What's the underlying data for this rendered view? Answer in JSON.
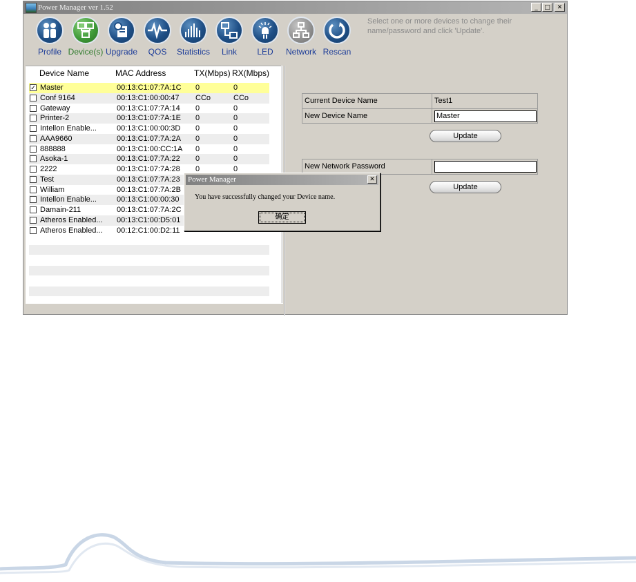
{
  "window": {
    "title": "Power Manager ver 1.52"
  },
  "window_buttons": {
    "minimize": "_",
    "maximize": "□",
    "close": "✕"
  },
  "toolbar": {
    "items": [
      {
        "label": "Profile",
        "icon": "profile-icon"
      },
      {
        "label": "Device(s)",
        "icon": "devices-icon"
      },
      {
        "label": "Upgrade",
        "icon": "upgrade-icon"
      },
      {
        "label": "QOS",
        "icon": "qos-icon"
      },
      {
        "label": "Statistics",
        "icon": "statistics-icon"
      },
      {
        "label": "Link",
        "icon": "link-icon"
      },
      {
        "label": "LED",
        "icon": "led-icon"
      },
      {
        "label": "Network",
        "icon": "network-icon"
      },
      {
        "label": "Rescan",
        "icon": "rescan-icon"
      }
    ],
    "active": "Device(s)"
  },
  "hint": "Select one or more devices to change their name/password and click 'Update'.",
  "device_list": {
    "columns": [
      "Device Name",
      "MAC Address",
      "TX(Mbps)",
      "RX(Mbps)"
    ],
    "rows": [
      {
        "checked": true,
        "name": "Master",
        "mac": "00:13:C1:07:7A:1C",
        "tx": "0",
        "rx": "0"
      },
      {
        "checked": false,
        "name": "Conf 9164",
        "mac": "00:13:C1:00:00:47",
        "tx": "CCo",
        "rx": "CCo"
      },
      {
        "checked": false,
        "name": "Gateway",
        "mac": "00:13:C1:07:7A:14",
        "tx": "0",
        "rx": "0"
      },
      {
        "checked": false,
        "name": "Printer-2",
        "mac": "00:13:C1:07:7A:1E",
        "tx": "0",
        "rx": "0"
      },
      {
        "checked": false,
        "name": "Intellon Enable...",
        "mac": "00:13:C1:00:00:3D",
        "tx": "0",
        "rx": "0"
      },
      {
        "checked": false,
        "name": "AAA9660",
        "mac": "00:13:C1:07:7A:2A",
        "tx": "0",
        "rx": "0"
      },
      {
        "checked": false,
        "name": "888888",
        "mac": "00:13:C1:00:CC:1A",
        "tx": "0",
        "rx": "0"
      },
      {
        "checked": false,
        "name": "Asoka-1",
        "mac": "00:13:C1:07:7A:22",
        "tx": "0",
        "rx": "0"
      },
      {
        "checked": false,
        "name": "2222",
        "mac": "00:13:C1:07:7A:28",
        "tx": "0",
        "rx": "0"
      },
      {
        "checked": false,
        "name": "Test",
        "mac": "00:13:C1:07:7A:23",
        "tx": "",
        "rx": ""
      },
      {
        "checked": false,
        "name": "William",
        "mac": "00:13:C1:07:7A:2B",
        "tx": "",
        "rx": ""
      },
      {
        "checked": false,
        "name": "Intellon Enable...",
        "mac": "00:13:C1:00:00:30",
        "tx": "",
        "rx": ""
      },
      {
        "checked": false,
        "name": "Damain-211",
        "mac": "00:13:C1:07:7A:2C",
        "tx": "",
        "rx": ""
      },
      {
        "checked": false,
        "name": "Atheros Enabled...",
        "mac": "00:13:C1:00:D5:01",
        "tx": "",
        "rx": ""
      },
      {
        "checked": false,
        "name": "Atheros Enabled...",
        "mac": "00:12:C1:00:D2:11",
        "tx": "",
        "rx": ""
      }
    ]
  },
  "device_form": {
    "current_label": "Current Device Name",
    "current_value": "Test1",
    "new_label": "New Device Name",
    "new_value": "Master",
    "update_label": "Update"
  },
  "password_form": {
    "label": "New Network Password",
    "value": "",
    "update_label": "Update"
  },
  "dialog": {
    "title": "Power Manager",
    "message": "You have successfully changed your Device name.",
    "ok_label": "确定",
    "close": "✕"
  },
  "colors": {
    "selected_row": "#ffff99",
    "toolbar_label": "#1c3c98",
    "active_label": "#2e7a2a",
    "window_bg": "#d4d0c8"
  }
}
